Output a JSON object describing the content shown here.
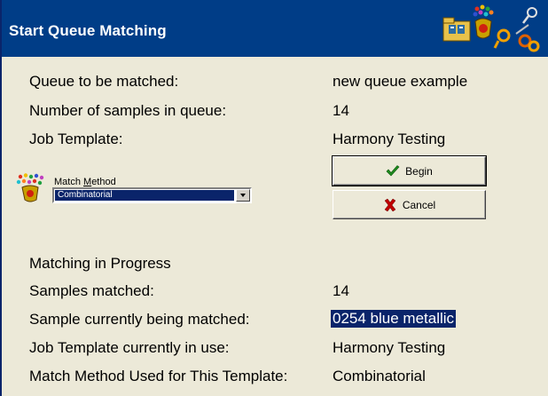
{
  "window": {
    "title": "Start Queue Matching"
  },
  "queue_info": {
    "queue_label": "Queue to be matched:",
    "queue_value": "new queue example",
    "samples_label": "Number of samples in queue:",
    "samples_value": "14",
    "template_label": "Job Template:",
    "template_value": "Harmony Testing"
  },
  "match_method": {
    "label_prefix": "Match ",
    "label_underlined": "M",
    "label_suffix": "ethod",
    "selected": "Combinatorial"
  },
  "buttons": {
    "begin_label": "Begin",
    "cancel_label": "Cancel"
  },
  "progress": {
    "heading": "Matching in Progress",
    "matched_label": "Samples matched:",
    "matched_value": "14",
    "current_label": "Sample currently being matched:",
    "current_value": "0254 blue metallic",
    "template_label": "Job Template currently in use:",
    "template_value": "Harmony Testing",
    "method_label": "Match Method Used for This Template:",
    "method_value": "Combinatorial"
  },
  "icons": {
    "title_folder": "folder-icon",
    "title_colors": "color-splash-icon",
    "title_search": "magnifier-icon",
    "match_method": "color-splash-icon",
    "begin": "checkmark-icon",
    "cancel": "x-icon"
  },
  "colors": {
    "titlebar": "#003d87",
    "selection": "#0a246a",
    "dialog_bg": "#ece9d8",
    "check_green": "#1f8c1f",
    "cancel_red": "#c00000"
  }
}
